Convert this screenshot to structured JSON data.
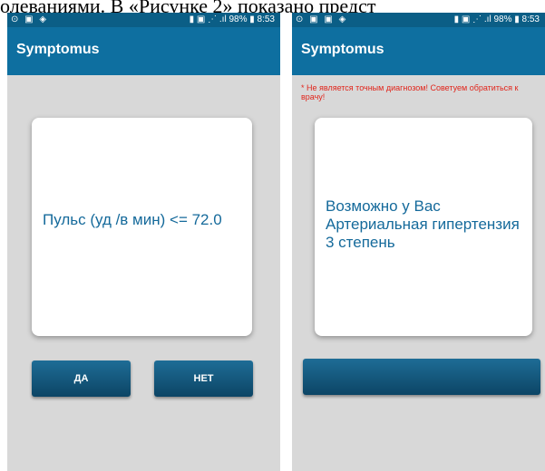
{
  "document": {
    "caption_fragment": "олеваниями. В «Рисунке 2» показано предст"
  },
  "screen_left": {
    "status_bar": {
      "left_icons": "⊙ ▣ ◈",
      "right_text": "▮ ▣ ⋰ .ıl 98% ▮ 8:53"
    },
    "app_title": "Symptomus",
    "question": "Пульс (уд /в мин) <= 72.0",
    "yes_button": "ДА",
    "no_button": "НЕТ"
  },
  "screen_right": {
    "status_bar": {
      "left_icons": "⊙ ▣ ▣ ◈",
      "right_text": "▮ ▣ ⋰ .ıl 98% ▮ 8:53"
    },
    "app_title": "Symptomus",
    "warning": "* Не является точным диагнозом! Советуем обратиться к врачу!",
    "diagnosis": "Возможно у Вас Артериальная гипертензия 3 степень",
    "action_button": ""
  },
  "colors": {
    "app_bar": "#0e6fa0",
    "status_bar": "#0b5e86",
    "card_text": "#156a9b",
    "warning_text": "#e1251b",
    "button": "#0c4565"
  }
}
